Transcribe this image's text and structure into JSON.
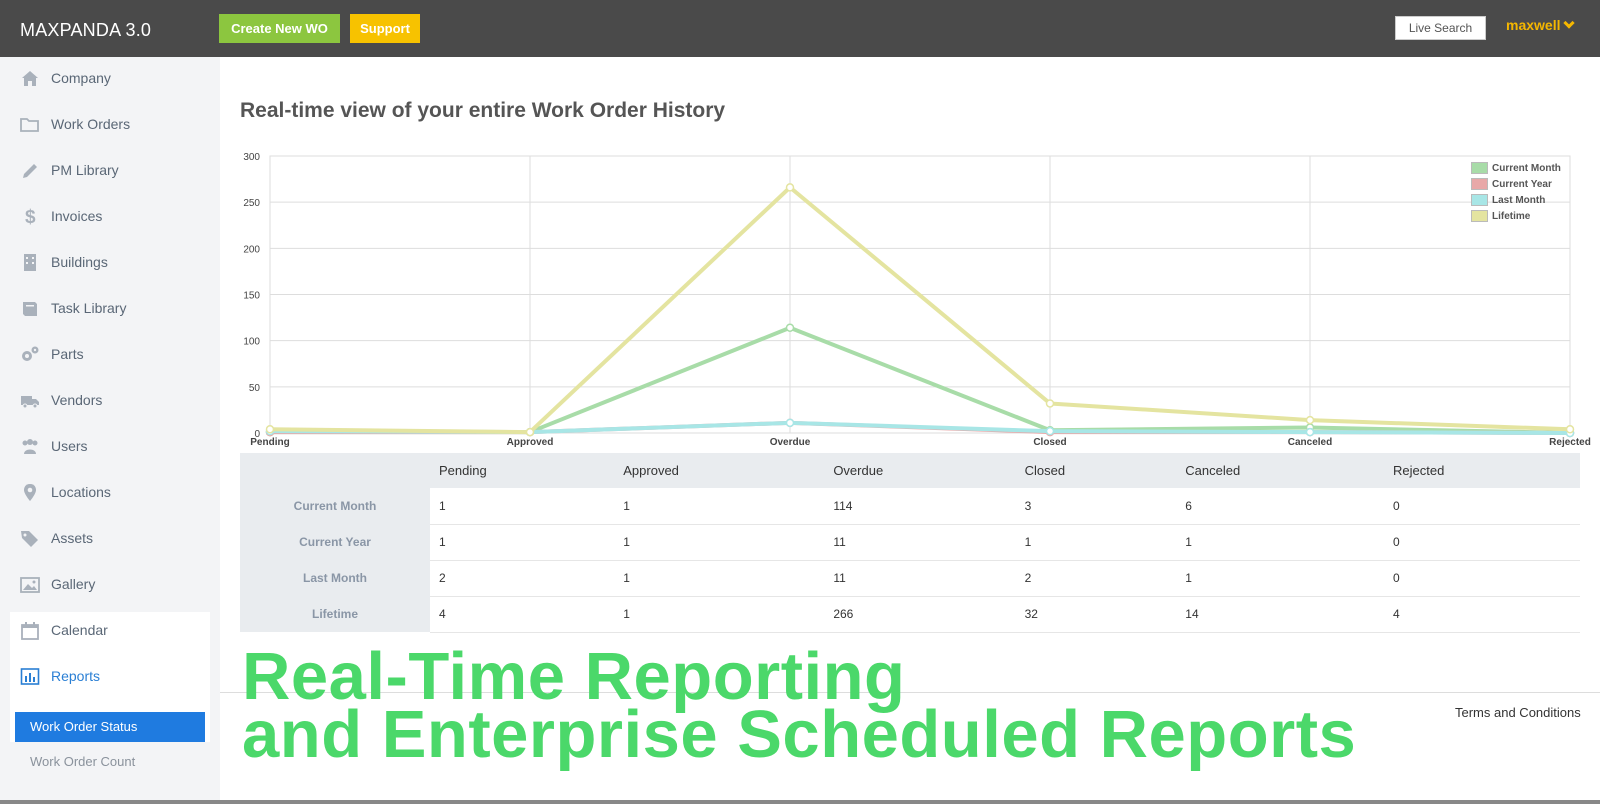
{
  "app": {
    "brand": "MAXPANDA 3.0",
    "create_wo_label": "Create New WO",
    "support_label": "Support",
    "live_search_label": "Live Search",
    "user_name": "maxwell",
    "accent_green": "#8cc63f",
    "accent_yellow": "#f7c200",
    "topbar_color": "#4a4a4a"
  },
  "sidebar": {
    "items": [
      {
        "label": "Company",
        "icon": "home-icon"
      },
      {
        "label": "Work Orders",
        "icon": "folder-icon"
      },
      {
        "label": "PM Library",
        "icon": "pencil-icon"
      },
      {
        "label": "Invoices",
        "icon": "dollar-icon"
      },
      {
        "label": "Buildings",
        "icon": "building-icon"
      },
      {
        "label": "Task Library",
        "icon": "book-icon"
      },
      {
        "label": "Parts",
        "icon": "gears-icon"
      },
      {
        "label": "Vendors",
        "icon": "truck-icon"
      },
      {
        "label": "Users",
        "icon": "users-icon"
      },
      {
        "label": "Locations",
        "icon": "map-pin-icon"
      },
      {
        "label": "Assets",
        "icon": "tags-icon"
      },
      {
        "label": "Gallery",
        "icon": "image-icon"
      },
      {
        "label": "Calendar",
        "icon": "calendar-icon"
      },
      {
        "label": "Reports",
        "icon": "bar-chart-icon"
      }
    ],
    "active_item": "Reports",
    "sub_items": [
      {
        "label": "Work Order Status",
        "active": true
      },
      {
        "label": "Work Order Count",
        "active": false
      }
    ]
  },
  "main": {
    "title": "Real-time view of your entire Work Order History"
  },
  "chart_data": {
    "type": "line",
    "categories": [
      "Pending",
      "Approved",
      "Overdue",
      "Closed",
      "Canceled",
      "Rejected"
    ],
    "ylim": [
      0,
      300
    ],
    "yticks": [
      0,
      50,
      100,
      150,
      200,
      250,
      300
    ],
    "grid": true,
    "legend_position": "top-right",
    "series": [
      {
        "name": "Current Month",
        "values": [
          1,
          1,
          114,
          3,
          6,
          0
        ],
        "color": "#a8dca8"
      },
      {
        "name": "Current Year",
        "values": [
          1,
          1,
          11,
          1,
          1,
          0
        ],
        "color": "#e8a8a8"
      },
      {
        "name": "Last Month",
        "values": [
          2,
          1,
          11,
          2,
          1,
          0
        ],
        "color": "#a8e6e6"
      },
      {
        "name": "Lifetime",
        "values": [
          4,
          1,
          266,
          32,
          14,
          4
        ],
        "color": "#e4e4a0"
      }
    ]
  },
  "table": {
    "columns": [
      "Pending",
      "Approved",
      "Overdue",
      "Closed",
      "Canceled",
      "Rejected"
    ],
    "rows": [
      {
        "label": "Current Month",
        "values": [
          "1",
          "1",
          "114",
          "3",
          "6",
          "0"
        ]
      },
      {
        "label": "Current Year",
        "values": [
          "1",
          "1",
          "11",
          "1",
          "1",
          "0"
        ]
      },
      {
        "label": "Last Month",
        "values": [
          "2",
          "1",
          "11",
          "2",
          "1",
          "0"
        ]
      },
      {
        "label": "Lifetime",
        "values": [
          "4",
          "1",
          "266",
          "32",
          "14",
          "4"
        ]
      }
    ]
  },
  "footer": {
    "terms_label": "Terms and Conditions"
  },
  "overlay": {
    "line1": "Real-Time Reporting",
    "line2": "and Enterprise Scheduled Reports",
    "color": "#4bd86a"
  }
}
